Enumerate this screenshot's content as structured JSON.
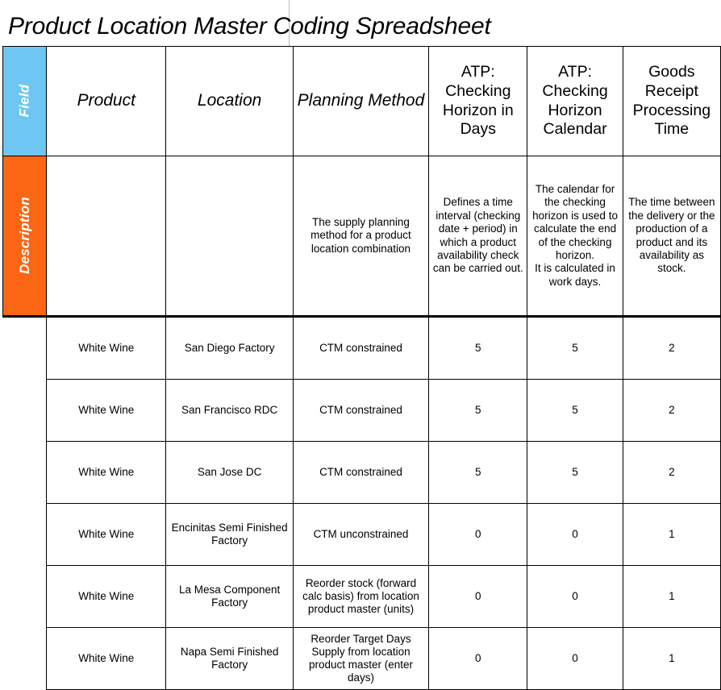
{
  "document": {
    "title": "Product Location Master Coding Spreadsheet"
  },
  "colors": {
    "field_label_bg": "#6dc7f2",
    "description_label_bg": "#fa6614",
    "label_text": "#ffffff",
    "grid_line": "#000000"
  },
  "table": {
    "row_labels": {
      "field": "Field",
      "description": "Description"
    },
    "columns": [
      {
        "key": "product",
        "header": "Product",
        "style": "italic"
      },
      {
        "key": "location",
        "header": "Location",
        "style": "italic"
      },
      {
        "key": "planning",
        "header": "Planning Method",
        "style": "italic"
      },
      {
        "key": "atp_days",
        "header": "ATP: Checking Horizon in Days",
        "style": "plain"
      },
      {
        "key": "atp_cal",
        "header": "ATP: Checking Horizon Calendar",
        "style": "plain"
      },
      {
        "key": "grpt",
        "header": "Goods Receipt Processing Time",
        "style": "plain"
      }
    ],
    "descriptions": {
      "product": "",
      "location": "",
      "planning": "The supply planning method for a product location combination",
      "atp_days": "Defines a time interval (checking date + period) in which a product availability check can be carried out.",
      "atp_cal": "The calendar for the checking horizon is used to calculate the end of the checking horizon.\nIt is calculated in work days.",
      "grpt": "The time between the delivery or the production of a product and its availability as stock."
    },
    "rows": [
      {
        "product": "White Wine",
        "location": "San Diego Factory",
        "planning": "CTM constrained",
        "atp_days": "5",
        "atp_cal": "5",
        "grpt": "2"
      },
      {
        "product": "White Wine",
        "location": "San Francisco RDC",
        "planning": "CTM constrained",
        "atp_days": "5",
        "atp_cal": "5",
        "grpt": "2"
      },
      {
        "product": "White Wine",
        "location": "San Jose DC",
        "planning": "CTM constrained",
        "atp_days": "5",
        "atp_cal": "5",
        "grpt": "2"
      },
      {
        "product": "White Wine",
        "location": "Encinitas Semi Finished Factory",
        "planning": "CTM unconstrained",
        "atp_days": "0",
        "atp_cal": "0",
        "grpt": "1"
      },
      {
        "product": "White Wine",
        "location": "La Mesa Component Factory",
        "planning": "Reorder stock (forward calc basis) from location product master (units)",
        "atp_days": "0",
        "atp_cal": "0",
        "grpt": "1"
      },
      {
        "product": "White Wine",
        "location": "Napa Semi Finished Factory",
        "planning": "Reorder Target Days Supply from location product master (enter days)",
        "atp_days": "0",
        "atp_cal": "0",
        "grpt": "1"
      }
    ]
  }
}
